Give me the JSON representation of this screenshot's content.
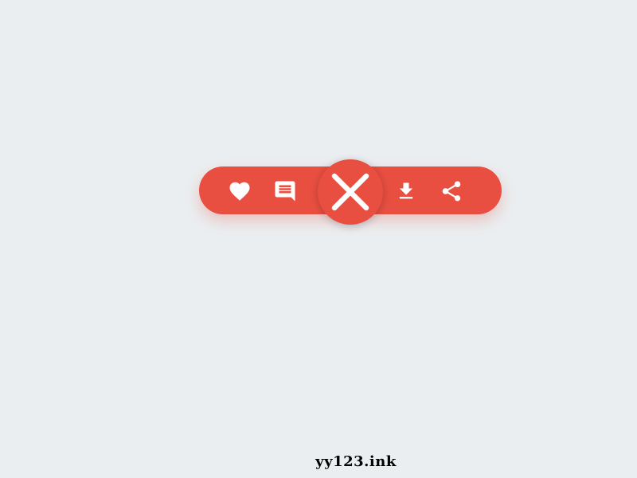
{
  "colors": {
    "background": "#eaeef0",
    "accent": "#e84f41",
    "icon": "#ffffff"
  },
  "action_menu": {
    "actions": [
      {
        "icon": "heart-icon",
        "action": "like"
      },
      {
        "icon": "message-icon",
        "action": "comment"
      },
      {
        "icon": "download-icon",
        "action": "download"
      },
      {
        "icon": "share-icon",
        "action": "share"
      }
    ],
    "center_button": {
      "icon": "close-icon",
      "state": "open"
    }
  },
  "watermark": {
    "text": "yy123.ink"
  }
}
